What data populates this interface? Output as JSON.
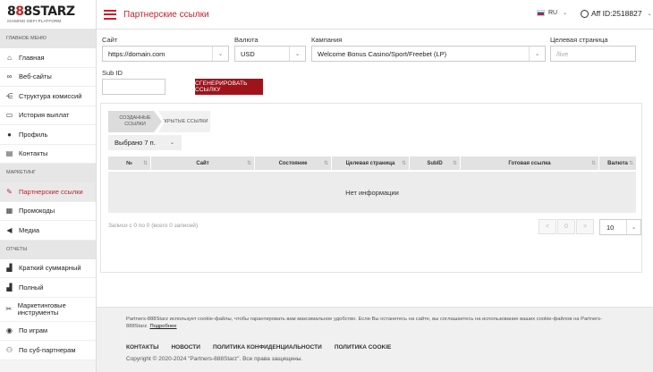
{
  "brand": {
    "logo_part1": "8",
    "logo_sep": "8",
    "logo_part2": "8STARZ",
    "subtitle": "iGAMING DEFI PLATFORM"
  },
  "sidebar": {
    "sections": [
      {
        "title": "Главное меню",
        "items": [
          {
            "label": "Главная",
            "icon": "home-icon"
          },
          {
            "label": "Веб-сайты",
            "icon": "link-icon"
          },
          {
            "label": "Структура комиссий",
            "icon": "share-icon"
          },
          {
            "label": "История выплат",
            "icon": "wallet-icon"
          },
          {
            "label": "Профиль",
            "icon": "user-icon"
          },
          {
            "label": "Контакты",
            "icon": "contact-icon"
          }
        ]
      },
      {
        "title": "Маркетинг",
        "items": [
          {
            "label": "Партнерские ссылки",
            "icon": "edit-icon",
            "active": true
          },
          {
            "label": "Промокоды",
            "icon": "ticket-icon"
          },
          {
            "label": "Медиа",
            "icon": "megaphone-icon"
          }
        ]
      },
      {
        "title": "Отчеты",
        "items": [
          {
            "label": "Краткий суммарный",
            "icon": "chart-icon"
          },
          {
            "label": "Полный",
            "icon": "chart-icon"
          },
          {
            "label": "Маркетинговые инструменты",
            "icon": "tools-icon"
          },
          {
            "label": "По играм",
            "icon": "gamepad-icon"
          },
          {
            "label": "По суб-партнерам",
            "icon": "group-icon"
          }
        ]
      }
    ]
  },
  "header": {
    "title": "Партнерские ссылки",
    "lang": "RU",
    "account": "Aff ID:2518827"
  },
  "form": {
    "site_label": "Сайт",
    "site_value": "https://domain.com",
    "currency_label": "Валюта",
    "currency_value": "USD",
    "campaign_label": "Кампания",
    "campaign_value": "Welcome Bonus Casino/Sport/Freebet (LP)",
    "target_label": "Целевая страница",
    "target_placeholder": "/live",
    "subid_label": "Sub ID",
    "subid_value": "",
    "generate_button": "СГЕНЕРИРОВАТЬ ССЫЛКУ"
  },
  "tabs": {
    "created": "СОЗДАННЫЕ ССЫЛКИ",
    "hidden": "СКРЫТЫЕ ССЫЛКИ"
  },
  "table": {
    "selected": "Выбрано 7 п.",
    "columns": [
      "№",
      "Сайт",
      "Состояние",
      "Целевая страница",
      "SubID",
      "Готовая ссылка",
      "Валюта"
    ],
    "empty": "Нет информации",
    "records": "Записи с 0 по 0 (всего 0 записей)",
    "pager_prev": "<",
    "pager_page": "0",
    "pager_next": ">",
    "per_page": "10"
  },
  "footer": {
    "cookie_text": "Partners-888Starz использует cookie-файлы, чтобы гарантировать вам максимальное удобство. Если Вы останетесь на сайте, вы соглашаетесь на использование ваших cookie-файлов на Partners-888Starz.",
    "cookie_link": "Подробнее",
    "links": [
      "КОНТАКТЫ",
      "НОВОСТИ",
      "ПОЛИТИКА КОНФИДЕНЦИАЛЬНОСТИ",
      "ПОЛИТИКА COOKIE"
    ],
    "copyright": "Copyright © 2020-2024 \"Partners-888Starz\". Все права защищены."
  }
}
